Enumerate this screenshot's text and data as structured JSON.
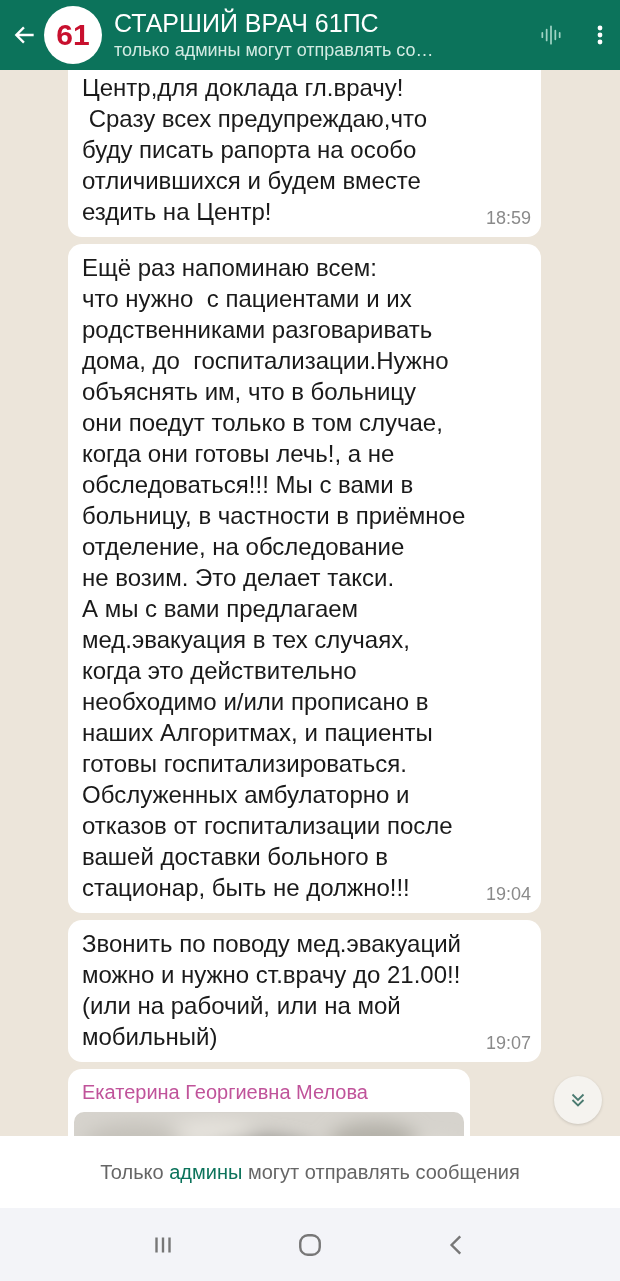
{
  "header": {
    "avatar_text": "61",
    "title": "СТАРШИЙ ВРАЧ 61ПС",
    "subtitle": "только админы могут отправлять со…"
  },
  "messages": [
    {
      "kind": "text",
      "text": "Центр,для доклада гл.врачу!\n Сразу всех предупреждаю,что\nбуду писать рапорта на особо\nотличившихся и будем вместе\nездить на Центр!",
      "time": "18:59"
    },
    {
      "kind": "text",
      "text": "Ещё раз напоминаю всем:\nчто нужно  с пациентами и их\nродственниками разговаривать\nдома, до  госпитализации.Нужно\nобъяснять им, что в больницу\nони поедут только в том случае,\nкогда они готовы лечь!, а не\nобследоваться!!! Мы с вами в\nбольницу, в частности в приёмное\nотделение, на обследование\nне возим. Это делает такси.\nА мы с вами предлагаем\nмед.эвакуация в тех случаях,\nкогда это действительно\nнеобходимо и/или прописано в\nнаших Алгоритмах, и пациенты\nготовы госпитализироваться.\nОбслуженных амбулаторно и\nотказов от госпитализации после\nвашей доставки больного в\nстационар, быть не должно!!!",
      "time": "19:04"
    },
    {
      "kind": "text",
      "text": "Звонить по поводу мед.эвакуаций\nможно и нужно ст.врачу до 21.00!!\n(или на рабочий, или на мой\nмобильный)",
      "time": "19:07"
    },
    {
      "sender": "Екатерина Георгиевна Мелова"
    }
  ],
  "footer": {
    "notice": "Только **админы** могут отправлять сообщения"
  }
}
